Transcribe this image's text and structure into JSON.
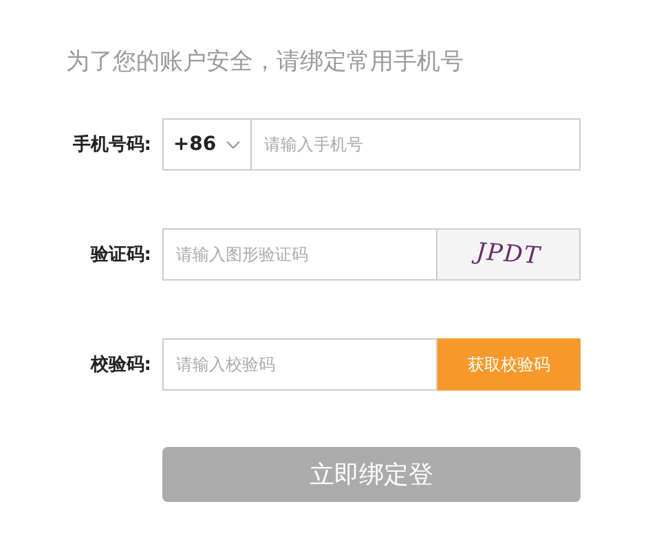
{
  "title": "为了您的账户安全，请绑定常用手机号",
  "fields": [
    {
      "kind": "phone",
      "label": "手机号码:",
      "prefix": "+86",
      "placeholder": "请输入手机号"
    },
    {
      "kind": "captcha",
      "label": "验证码:",
      "placeholder": "请输入图形验证码",
      "captcha": "JPDT"
    },
    {
      "kind": "sms",
      "label": "校验码:",
      "placeholder": "请输入校验码",
      "button": "获取校验码"
    }
  ],
  "submit": {
    "label": "立即绑定登",
    "disabled": true
  }
}
